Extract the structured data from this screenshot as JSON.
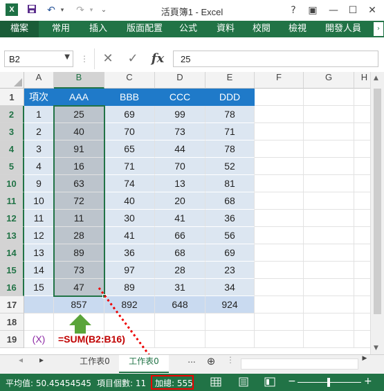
{
  "window": {
    "title": "活頁簿1 - Excel",
    "app_icon_label": "X",
    "help": "?",
    "restore_ribbon": "▣",
    "minimize": "—",
    "maximize": "☐",
    "close": "✕"
  },
  "ribbon": {
    "tabs": [
      "檔案",
      "常用",
      "插入",
      "版面配置",
      "公式",
      "資料",
      "校閱",
      "檢視",
      "開發人員"
    ],
    "scroll": "›"
  },
  "formula_bar": {
    "name_box": "B2",
    "cancel_icon": "✕",
    "enter_icon": "✓",
    "fx_label": "fx",
    "value": "25"
  },
  "columns": [
    "A",
    "B",
    "C",
    "D",
    "E",
    "F",
    "G",
    "H"
  ],
  "rows": [
    "1",
    "2",
    "3",
    "4",
    "5",
    "10",
    "11",
    "12",
    "13",
    "14",
    "15",
    "16",
    "17",
    "18",
    "19"
  ],
  "table": {
    "headers": [
      "項次",
      "AAA",
      "BBB",
      "CCC",
      "DDD"
    ],
    "data": [
      [
        "1",
        "25",
        "69",
        "99",
        "78"
      ],
      [
        "2",
        "40",
        "70",
        "73",
        "71"
      ],
      [
        "3",
        "91",
        "65",
        "44",
        "78"
      ],
      [
        "4",
        "16",
        "71",
        "70",
        "52"
      ],
      [
        "9",
        "63",
        "74",
        "13",
        "81"
      ],
      [
        "10",
        "72",
        "40",
        "20",
        "68"
      ],
      [
        "11",
        "11",
        "30",
        "41",
        "36"
      ],
      [
        "12",
        "28",
        "41",
        "66",
        "56"
      ],
      [
        "13",
        "89",
        "36",
        "68",
        "69"
      ],
      [
        "14",
        "73",
        "97",
        "28",
        "23"
      ],
      [
        "15",
        "47",
        "89",
        "31",
        "34"
      ]
    ],
    "totals": [
      "",
      "857",
      "892",
      "648",
      "924"
    ]
  },
  "annotation": {
    "label": "(X)",
    "formula": "=SUM(B2:B16)"
  },
  "sheets": {
    "nav_left": "◂",
    "nav_right": "▸",
    "tabs": [
      "工作表0",
      "工作表0"
    ],
    "more": "...",
    "add": "⊕"
  },
  "status": {
    "average": "平均值: 50.45454545",
    "count": "項目個數: 11",
    "sum": "加總: 555",
    "zoom_minus": "−",
    "zoom_plus": "+"
  },
  "colors": {
    "excel_green": "#217346",
    "header_blue": "#1f7ac9",
    "band_blue": "#dce6f1",
    "highlight_red": "#e00000"
  }
}
